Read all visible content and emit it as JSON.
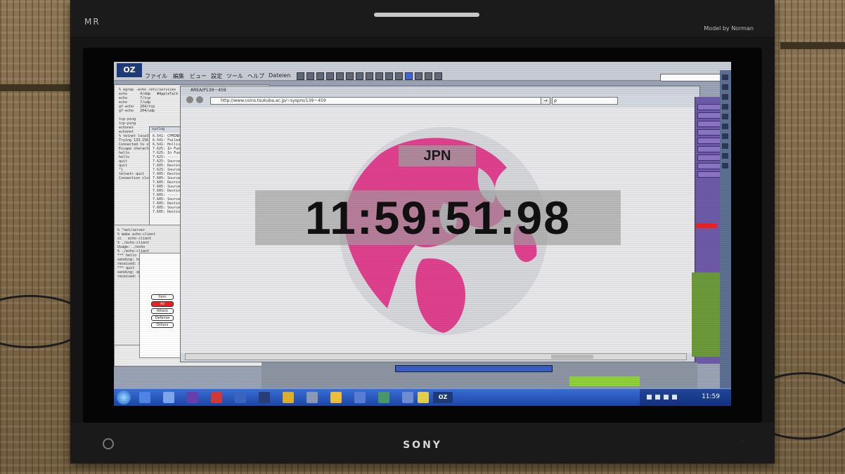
{
  "monitor": {
    "brand": "SONY",
    "top_left_tag": "MR",
    "top_right_tag": "Model by Norman"
  },
  "app": {
    "logo": "OZ",
    "menu": [
      "ファイル",
      "編集",
      "ビュー",
      "設定",
      "ツール",
      "ヘルプ",
      "Dateien"
    ]
  },
  "browser": {
    "title": "AREA/P139－459",
    "url": "http://www.coins.tsukuba.ac.jp/~syspro/139－459",
    "go_label": "→",
    "search_placeholder": "ρ"
  },
  "display": {
    "region": "JPN",
    "clock": "11:59:51:98"
  },
  "side_menu": {
    "items": [
      "Item",
      "All",
      "Attack",
      "Defense",
      "Others"
    ],
    "active_index": 1
  },
  "taskbar": {
    "time": "11:59",
    "pinned_label": "OZ"
  },
  "colors": {
    "globe_pink": "#e0418f",
    "taskbar_blue": "#1d47a8",
    "purple_panel": "#6d5aa8",
    "active_red": "#e22222"
  },
  "icons": [
    "start-orb-icon",
    "browser-icon",
    "folder-icon",
    "media-icon",
    "network-icon",
    "volume-icon",
    "power-icon"
  ]
}
